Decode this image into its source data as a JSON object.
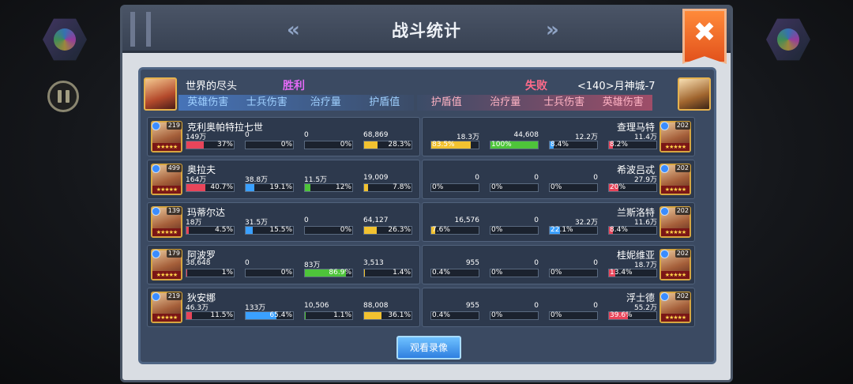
{
  "title": "战斗统计",
  "nav": {
    "prev": "«",
    "next": "»"
  },
  "close_label": "✖",
  "left_team": {
    "name": "世界的尽头",
    "result": "胜利"
  },
  "right_team": {
    "name": "<140>月神城-7",
    "result": "失败"
  },
  "columns_left": [
    "英雄伤害",
    "士兵伤害",
    "治疗量",
    "护盾值"
  ],
  "columns_right": [
    "护盾值",
    "治疗量",
    "士兵伤害",
    "英雄伤害"
  ],
  "colors": {
    "hero_damage": "#e8455a",
    "soldier_damage": "#3aa0ff",
    "healing": "#4ec43a",
    "shield": "#f2c230"
  },
  "left_heroes": [
    {
      "name": "克利奥帕特拉七世",
      "level": "219",
      "stats": [
        {
          "value": "149万",
          "pct": "37%",
          "frac": 0.37,
          "type": "hero_damage"
        },
        {
          "value": "0",
          "pct": "0%",
          "frac": 0,
          "type": "soldier_damage"
        },
        {
          "value": "0",
          "pct": "0%",
          "frac": 0,
          "type": "healing"
        },
        {
          "value": "68,869",
          "pct": "28.3%",
          "frac": 0.283,
          "type": "shield"
        }
      ]
    },
    {
      "name": "奥拉夫",
      "level": "499",
      "stats": [
        {
          "value": "164万",
          "pct": "40.7%",
          "frac": 0.407,
          "type": "hero_damage"
        },
        {
          "value": "38.8万",
          "pct": "19.1%",
          "frac": 0.191,
          "type": "soldier_damage"
        },
        {
          "value": "11.5万",
          "pct": "12%",
          "frac": 0.12,
          "type": "healing"
        },
        {
          "value": "19,009",
          "pct": "7.8%",
          "frac": 0.078,
          "type": "shield"
        }
      ]
    },
    {
      "name": "玛蒂尔达",
      "level": "139",
      "stats": [
        {
          "value": "18万",
          "pct": "4.5%",
          "frac": 0.045,
          "type": "hero_damage"
        },
        {
          "value": "31.5万",
          "pct": "15.5%",
          "frac": 0.155,
          "type": "soldier_damage"
        },
        {
          "value": "0",
          "pct": "0%",
          "frac": 0,
          "type": "healing"
        },
        {
          "value": "64,127",
          "pct": "26.3%",
          "frac": 0.263,
          "type": "shield"
        }
      ]
    },
    {
      "name": "阿波罗",
      "level": "179",
      "stats": [
        {
          "value": "38,648",
          "pct": "1%",
          "frac": 0.01,
          "type": "hero_damage"
        },
        {
          "value": "0",
          "pct": "0%",
          "frac": 0,
          "type": "soldier_damage"
        },
        {
          "value": "83万",
          "pct": "86.9%",
          "frac": 0.869,
          "type": "healing"
        },
        {
          "value": "3,513",
          "pct": "1.4%",
          "frac": 0.014,
          "type": "shield"
        }
      ]
    },
    {
      "name": "狄安娜",
      "level": "219",
      "stats": [
        {
          "value": "46.3万",
          "pct": "11.5%",
          "frac": 0.115,
          "type": "hero_damage"
        },
        {
          "value": "133万",
          "pct": "65.4%",
          "frac": 0.654,
          "type": "soldier_damage"
        },
        {
          "value": "10,506",
          "pct": "1.1%",
          "frac": 0.011,
          "type": "healing"
        },
        {
          "value": "88,008",
          "pct": "36.1%",
          "frac": 0.361,
          "type": "shield"
        }
      ]
    }
  ],
  "right_heroes": [
    {
      "name": "查理马特",
      "level": "202",
      "stats": [
        {
          "value": "18.3万",
          "pct": "83.5%",
          "frac": 0.835,
          "type": "shield"
        },
        {
          "value": "44,608",
          "pct": "100%",
          "frac": 1.0,
          "type": "healing"
        },
        {
          "value": "12.2万",
          "pct": "8.4%",
          "frac": 0.084,
          "type": "soldier_damage"
        },
        {
          "value": "11.4万",
          "pct": "8.2%",
          "frac": 0.082,
          "type": "hero_damage"
        }
      ]
    },
    {
      "name": "希波吕忒",
      "level": "202",
      "stats": [
        {
          "value": "0",
          "pct": "0%",
          "frac": 0,
          "type": "shield"
        },
        {
          "value": "0",
          "pct": "0%",
          "frac": 0,
          "type": "healing"
        },
        {
          "value": "0",
          "pct": "0%",
          "frac": 0,
          "type": "soldier_damage"
        },
        {
          "value": "27.9万",
          "pct": "20%",
          "frac": 0.2,
          "type": "hero_damage"
        }
      ]
    },
    {
      "name": "兰斯洛特",
      "level": "202",
      "stats": [
        {
          "value": "16,576",
          "pct": "7.6%",
          "frac": 0.076,
          "type": "shield"
        },
        {
          "value": "0",
          "pct": "0%",
          "frac": 0,
          "type": "healing"
        },
        {
          "value": "32.2万",
          "pct": "22.1%",
          "frac": 0.221,
          "type": "soldier_damage"
        },
        {
          "value": "11.6万",
          "pct": "8.4%",
          "frac": 0.084,
          "type": "hero_damage"
        }
      ]
    },
    {
      "name": "桂妮维亚",
      "level": "202",
      "stats": [
        {
          "value": "955",
          "pct": "0.4%",
          "frac": 0.004,
          "type": "shield"
        },
        {
          "value": "0",
          "pct": "0%",
          "frac": 0,
          "type": "healing"
        },
        {
          "value": "0",
          "pct": "0%",
          "frac": 0,
          "type": "soldier_damage"
        },
        {
          "value": "18.7万",
          "pct": "13.4%",
          "frac": 0.134,
          "type": "hero_damage"
        }
      ]
    },
    {
      "name": "浮士德",
      "level": "202",
      "stats": [
        {
          "value": "955",
          "pct": "0.4%",
          "frac": 0.004,
          "type": "shield"
        },
        {
          "value": "0",
          "pct": "0%",
          "frac": 0,
          "type": "healing"
        },
        {
          "value": "0",
          "pct": "0%",
          "frac": 0,
          "type": "soldier_damage"
        },
        {
          "value": "55.2万",
          "pct": "39.6%",
          "frac": 0.396,
          "type": "hero_damage"
        }
      ]
    }
  ],
  "replay_label": "观看录像"
}
